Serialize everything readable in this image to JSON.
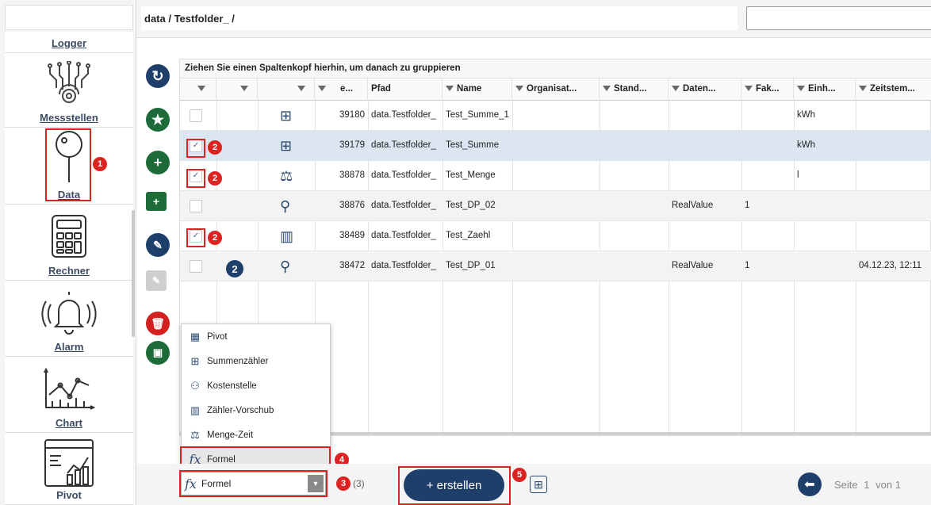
{
  "sidebar": {
    "items": [
      {
        "label": "Logger",
        "icon": "logger-icon"
      },
      {
        "label": "Messstellen",
        "icon": "sensor-network-icon"
      },
      {
        "label": "Data",
        "icon": "pin-icon"
      },
      {
        "label": "Rechner",
        "icon": "calculator-icon"
      },
      {
        "label": "Alarm",
        "icon": "bell-icon"
      },
      {
        "label": "Chart",
        "icon": "line-chart-icon"
      },
      {
        "label": "Pivot",
        "icon": "pivot-icon"
      }
    ]
  },
  "breadcrumb": "data / Testfolder_ /",
  "grid": {
    "group_hint": "Ziehen Sie einen Spaltenkopf hierhin, um danach zu gruppieren",
    "columns": [
      "e...",
      "Pfad",
      "Name",
      "Organisat...",
      "Stand...",
      "Daten...",
      "Fak...",
      "Einh...",
      "Zeitstem..."
    ],
    "rows": [
      {
        "checked": false,
        "icon": "summenzaehler-icon",
        "glyph": "⊞",
        "id": "39180",
        "pfad": "data.Testfolder_",
        "name": "Test_Summe_1",
        "daten": "",
        "fak": "",
        "einh": "kWh",
        "zeit": "",
        "selected": false
      },
      {
        "checked": true,
        "icon": "summenzaehler-icon",
        "glyph": "⊞",
        "id": "39179",
        "pfad": "data.Testfolder_",
        "name": "Test_Summe",
        "daten": "",
        "fak": "",
        "einh": "kWh",
        "zeit": "",
        "selected": true
      },
      {
        "checked": true,
        "icon": "menge-zeit-icon",
        "glyph": "⚖",
        "id": "38878",
        "pfad": "data.Testfolder_",
        "name": "Test_Menge",
        "daten": "",
        "fak": "",
        "einh": "l",
        "zeit": "",
        "selected": false
      },
      {
        "checked": false,
        "icon": "pin-icon",
        "glyph": "⚲",
        "id": "38876",
        "pfad": "data.Testfolder_",
        "name": "Test_DP_02",
        "daten": "RealValue",
        "fak": "1",
        "einh": "",
        "zeit": "",
        "selected": false
      },
      {
        "checked": true,
        "icon": "zaehler-vorschub-icon",
        "glyph": "▥",
        "id": "38489",
        "pfad": "data.Testfolder_",
        "name": "Test_Zaehl",
        "daten": "",
        "fak": "",
        "einh": "",
        "zeit": "",
        "selected": false
      },
      {
        "checked": false,
        "icon": "pin-icon",
        "glyph": "⚲",
        "id": "38472",
        "pfad": "data.Testfolder_",
        "name": "Test_DP_01",
        "daten": "RealValue",
        "fak": "1",
        "einh": "",
        "zeit": "04.12.23, 12:11",
        "selected": false
      }
    ]
  },
  "dropdown": {
    "options": [
      "Pivot",
      "Summenzähler",
      "Kostenstelle",
      "Zähler-Vorschub",
      "Menge-Zeit",
      "Formel"
    ],
    "selected": "Formel"
  },
  "footer": {
    "count": "(3)",
    "create_label": "+ erstellen",
    "page_text": "Seite",
    "page_num": "1",
    "of_text": "von 1"
  },
  "annotations": {
    "n1": "1",
    "n2": "2",
    "n3": "3",
    "n4": "4",
    "n5": "5"
  },
  "colors": {
    "accent": "#1f3f6b",
    "annotation": "#dd2222",
    "selected_row": "#dce6f1"
  }
}
